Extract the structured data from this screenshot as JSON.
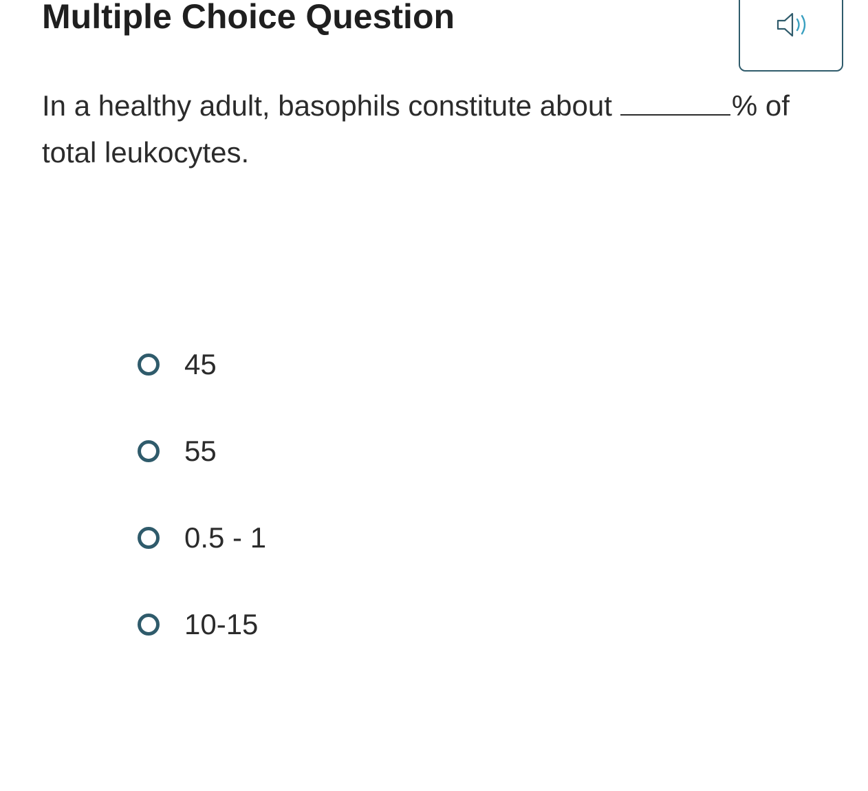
{
  "header": {
    "title": "Multiple Choice Question",
    "audio_icon": "speaker-icon"
  },
  "question": {
    "text_before": "In a healthy adult, basophils constitute about",
    "text_after": "% of total leukocytes."
  },
  "options": [
    {
      "label": "45",
      "selected": false
    },
    {
      "label": "55",
      "selected": false
    },
    {
      "label": "0.5 - 1",
      "selected": false
    },
    {
      "label": "10-15",
      "selected": false
    }
  ],
  "colors": {
    "accent": "#2f5b6b",
    "speaker_waves": "#3aa0c0",
    "text": "#2b2b2b"
  }
}
